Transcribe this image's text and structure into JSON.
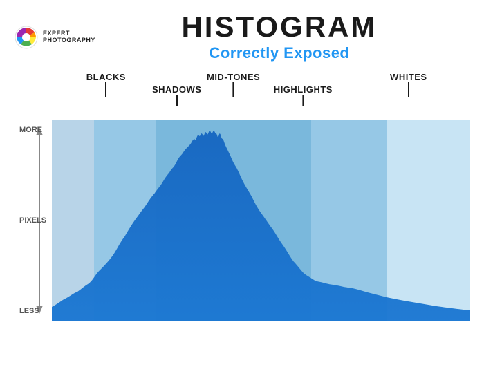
{
  "logo": {
    "line1": "EXPERT",
    "line2": "PHOTOGRAPHY"
  },
  "title": "HISTOGRAM",
  "subtitle": "Correctly Exposed",
  "yaxis": {
    "more": "MORE",
    "pixels": "PIXELS",
    "less": "LESS"
  },
  "zones": {
    "blacks": "BLACKS",
    "shadows": "SHADOWS",
    "midtones": "MID-TONES",
    "highlights": "HIGHLIGHTS",
    "whites": "WHITES"
  },
  "colors": {
    "accent": "#2196F3",
    "histogram_fill": "#1565C0",
    "band_dark": "#90b8d0",
    "band_mid": "#7ab8dc",
    "band_light": "#c8e4f4"
  }
}
